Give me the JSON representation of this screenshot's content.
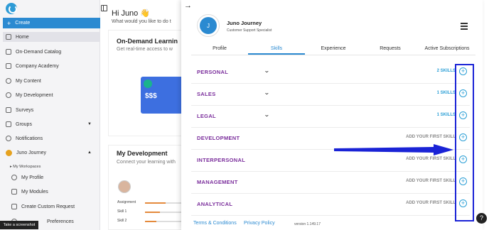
{
  "sidebar": {
    "create_label": "Create",
    "items": [
      {
        "label": "Home"
      },
      {
        "label": "On-Demand Catalog"
      },
      {
        "label": "Company Academy"
      },
      {
        "label": "My Content"
      },
      {
        "label": "My Development"
      },
      {
        "label": "Surveys"
      },
      {
        "label": "Groups"
      },
      {
        "label": "Notifications"
      },
      {
        "label": "Juno Journey"
      }
    ],
    "sub_heading": "My Workspaces",
    "sub_items": [
      {
        "label": "My Profile"
      },
      {
        "label": "My Modules"
      },
      {
        "label": "Create Custom Request"
      },
      {
        "label": "Preferences"
      }
    ]
  },
  "dashboard": {
    "greeting": "Hi Juno 👋",
    "greeting_sub": "What would you like to do t",
    "ondemand_title": "On-Demand Learnin",
    "ondemand_sub": "Get real-time access to w",
    "promo_text": "$$$",
    "dev_title": "My Development",
    "dev_sub": "Connect your learning with",
    "dev_labels": [
      "Assignment",
      "Skill 1",
      "Skill 2"
    ],
    "dev_progress": [
      0.55,
      0.4,
      0.3
    ]
  },
  "tooltip": "Take a screenshot",
  "panel": {
    "avatar_initial": "J",
    "name": "Juno Journey",
    "role": "Customer Support Specialist",
    "tabs": [
      "Profile",
      "Skills",
      "Experience",
      "Requests",
      "Active Subscriptions"
    ],
    "active_tab": "Skills",
    "skills": [
      {
        "name": "PERSONAL",
        "count": "2 SKILLS",
        "expandable": true
      },
      {
        "name": "SALES",
        "count": "1 SKILLS",
        "expandable": true
      },
      {
        "name": "LEGAL",
        "count": "1 SKILLS",
        "expandable": true
      },
      {
        "name": "DEVELOPMENT",
        "count": "ADD YOUR FIRST SKILL",
        "expandable": false
      },
      {
        "name": "INTERPERSONAL",
        "count": "ADD YOUR FIRST SKILL",
        "expandable": false
      },
      {
        "name": "MANAGEMENT",
        "count": "ADD YOUR FIRST SKILL",
        "expandable": false
      },
      {
        "name": "ANALYTICAL",
        "count": "ADD YOUR FIRST SKILL",
        "expandable": false
      }
    ],
    "footer_terms": "Terms & Conditions",
    "footer_privacy": "Privacy Policy",
    "version": "version 1.149.17"
  },
  "help_label": "?",
  "colors": {
    "accent": "#2b8ad1",
    "skill_purple": "#7b2f9c",
    "annotation": "#1a23d6"
  }
}
